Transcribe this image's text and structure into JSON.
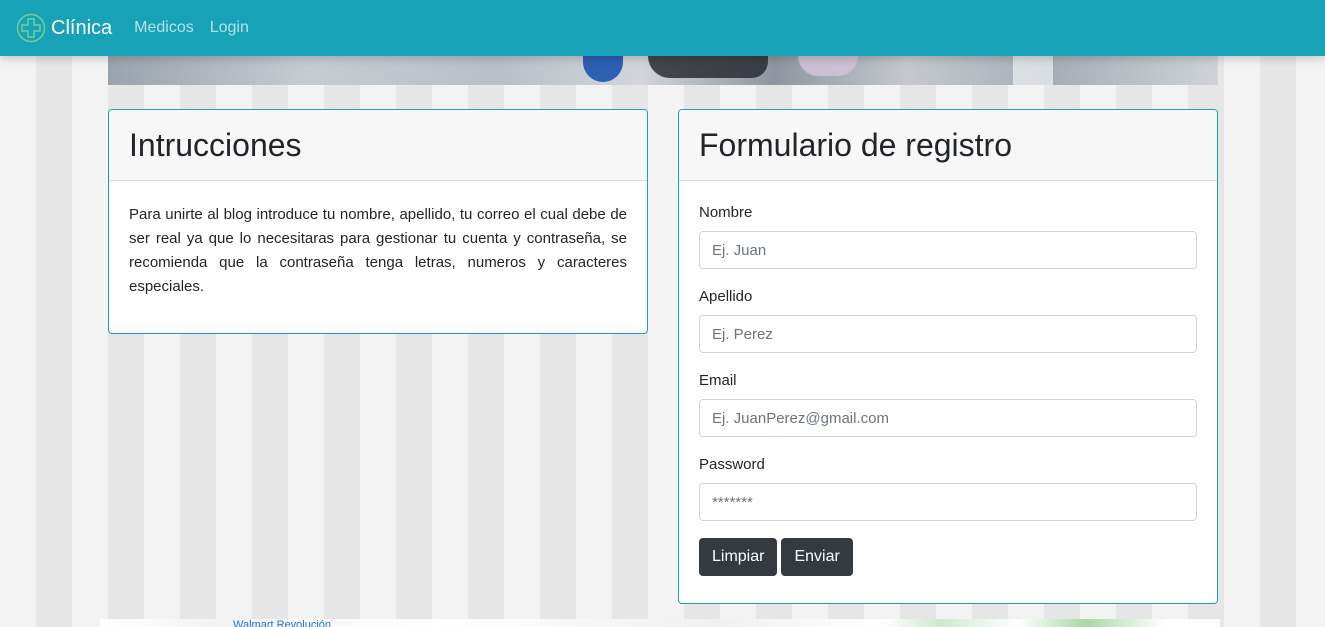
{
  "navbar": {
    "brand": "Clínica",
    "links": [
      "Medicos",
      "Login"
    ],
    "color": "#17a2b8"
  },
  "instructions": {
    "title": "Intrucciones",
    "text": "Para unirte al blog introduce tu nombre, apellido, tu correo el cual debe de ser real ya que lo necesitaras para gestionar tu cuenta y contraseña, se recomienda que la contraseña tenga letras, numeros y caracteres especiales."
  },
  "form": {
    "title": "Formulario de registro",
    "fields": [
      {
        "label": "Nombre",
        "placeholder": "Ej. Juan",
        "value": ""
      },
      {
        "label": "Apellido",
        "placeholder": "Ej. Perez",
        "value": ""
      },
      {
        "label": "Email",
        "placeholder": "Ej. JuanPerez@gmail.com",
        "value": ""
      },
      {
        "label": "Password",
        "placeholder": "*******",
        "value": ""
      }
    ],
    "buttons": {
      "clear": "Limpiar",
      "submit": "Enviar"
    }
  },
  "map": {
    "label": "Walmart Revolución"
  },
  "icons": {
    "brand": "medical-cross-icon"
  }
}
